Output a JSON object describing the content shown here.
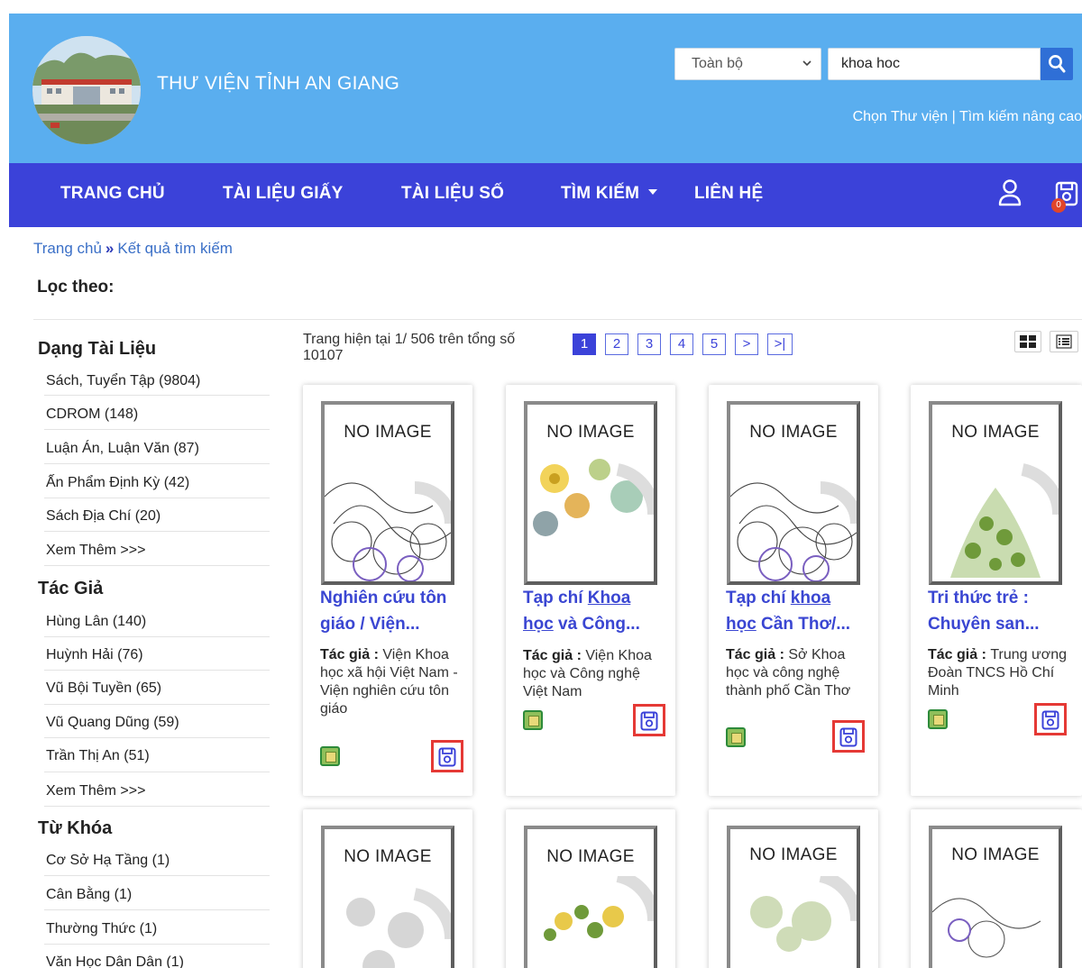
{
  "header": {
    "site_title": "THƯ VIỆN TỈNH AN GIANG",
    "scope_select": "Toàn bộ",
    "search_value": "khoa hoc",
    "links": {
      "choose_library": "Chọn Thư viện",
      "separator": " | ",
      "advanced_search": "Tìm kiếm nâng cao"
    }
  },
  "nav": {
    "items": [
      "TRANG CHỦ",
      "TÀI LIỆU GIẤY",
      "TÀI LIỆU SỐ",
      "TÌM KIẾM",
      "LIÊN HỆ"
    ],
    "cart_count": "0"
  },
  "breadcrumb": {
    "home": "Trang chủ",
    "sep": "»",
    "current": "Kết quả tìm kiếm"
  },
  "filter_label": "Lọc theo:",
  "sidebar": {
    "groups": [
      {
        "heading": "Dạng Tài Liệu",
        "items": [
          "Sách, Tuyển Tập (9804)",
          "CDROM (148)",
          "Luận Án, Luận Văn (87)",
          "Ấn Phẩm Định Kỳ (42)",
          "Sách Địa Chí (20)",
          "Xem Thêm >>>"
        ]
      },
      {
        "heading": "Tác Giả",
        "items": [
          "Hùng Lân (140)",
          "Huỳnh Hải (76)",
          "Vũ Bội Tuyền (65)",
          "Vũ Quang Dũng (59)",
          "Trần Thị An (51)",
          "Xem Thêm >>>"
        ]
      },
      {
        "heading": "Từ Khóa",
        "items": [
          "Cơ Sở Hạ Tầng (1)",
          "Cân Bằng (1)",
          "Thường Thức (1)",
          "Văn Học Dân Dân (1)"
        ]
      }
    ]
  },
  "results": {
    "info": "Trang hiện tại 1/ 506 trên tổng số 10107",
    "pages": [
      "1",
      "2",
      "3",
      "4",
      "5",
      ">",
      ">|"
    ],
    "active_page": "1"
  },
  "cards": [
    {
      "noimage": "NO IMAGE",
      "title_a": "Nghiên cứu tôn",
      "title_b": "giáo / Viện...",
      "author_label": "Tác giả",
      "author": "Viện Khoa học xã hội Việt Nam - Viện nghiên cứu tôn giáo"
    },
    {
      "noimage": "NO IMAGE",
      "title_a1": "Tạp chí ",
      "title_a2": "Khoa",
      "title_b1": "học",
      "title_b2": " và Công...",
      "author_label": "Tác giả",
      "author": "Viện Khoa học và Công nghệ Việt Nam"
    },
    {
      "noimage": "NO IMAGE",
      "title_a1": "Tạp chí ",
      "title_a2": "khoa",
      "title_b1": "học",
      "title_b2": " Cần Thơ/...",
      "author_label": "Tác giả",
      "author": "Sở Khoa học và công nghệ thành phố Cần Thơ"
    },
    {
      "noimage": "NO IMAGE",
      "title_a": "Tri thức trẻ :",
      "title_b": "Chuyên san...",
      "author_label": "Tác giả",
      "author": "Trung ương Đoàn TNCS Hồ Chí Minh"
    },
    {
      "noimage": "NO IMAGE"
    },
    {
      "noimage": "NO IMAGE"
    },
    {
      "noimage": "NO IMAGE"
    },
    {
      "noimage": "NO IMAGE"
    }
  ],
  "colors": {
    "header_bg": "#5aaeef",
    "nav_bg": "#3b42d9",
    "link": "#3a46d2",
    "save_border": "#e53935"
  }
}
